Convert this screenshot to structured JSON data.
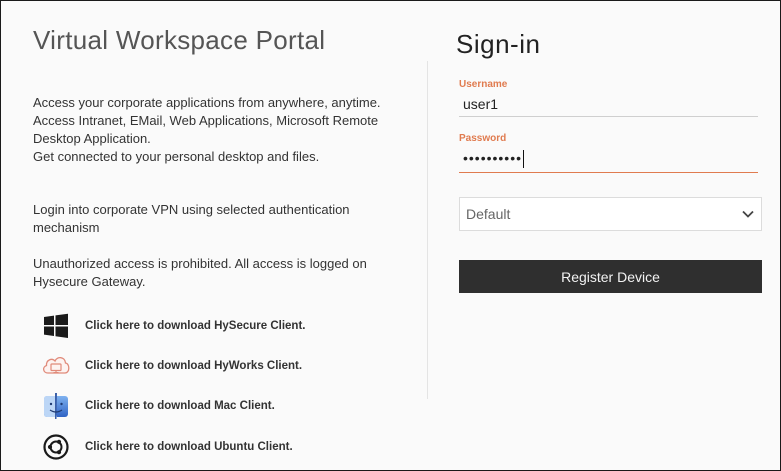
{
  "portal": {
    "title": "Virtual Workspace Portal",
    "para1": [
      "Access your corporate applications from anywhere, anytime.",
      "Access Intranet, EMail, Web Applications, Microsoft Remote Desktop Application.",
      "Get connected to your personal desktop and files."
    ],
    "para2": "Login into corporate VPN using selected authentication mechanism",
    "para3": "Unauthorized access is prohibited. All access is logged on Hysecure Gateway."
  },
  "downloads": [
    {
      "label": "Click here to download HySecure Client.",
      "icon": "windows-icon"
    },
    {
      "label": "Click here to download HyWorks Client.",
      "icon": "cloud-monitor-icon"
    },
    {
      "label": "Click here to download Mac Client.",
      "icon": "mac-finder-icon"
    },
    {
      "label": "Click here to download Ubuntu Client.",
      "icon": "ubuntu-icon"
    }
  ],
  "signin": {
    "title": "Sign-in",
    "username_label": "Username",
    "username_value": "user1",
    "password_label": "Password",
    "password_value": "••••••••••",
    "auth_select_value": "Default",
    "register_button": "Register Device"
  },
  "colors": {
    "accent": "#e07b4f",
    "button_bg": "#2f2f2f",
    "windows_icon": "#1a1a1a",
    "hyworks_icon": "#e08a7a",
    "mac_icon": "#4a7fd6"
  }
}
